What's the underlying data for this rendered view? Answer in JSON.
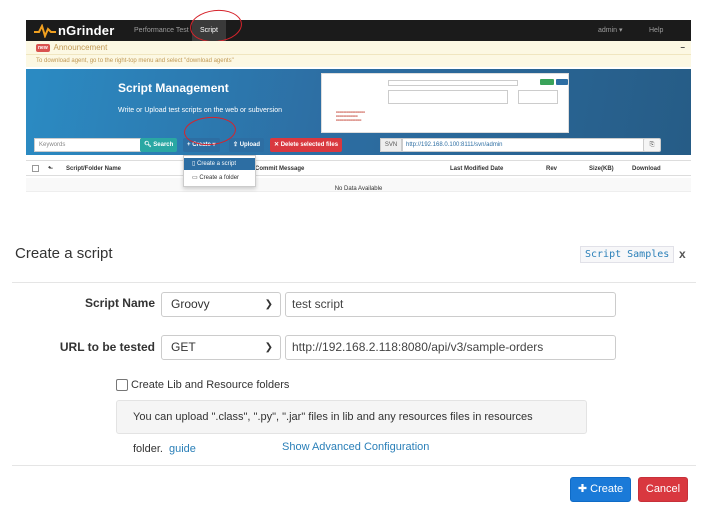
{
  "app": {
    "name": "nGrinder"
  },
  "nav": {
    "performance_test": "Performance Test",
    "script": "Script",
    "admin": "admin",
    "help": "Help"
  },
  "announcement": {
    "badge": "new",
    "title": "Announcement",
    "collapse": "–",
    "message": "To download agent, go to the right-top menu and select \"download agents\""
  },
  "banner": {
    "title": "Script Management",
    "subtitle": "Write or Upload test scripts on the web or subversion"
  },
  "toolbar": {
    "keywords_placeholder": "Keywords",
    "search": "Search",
    "create": "Create",
    "upload": "Upload",
    "delete_selected": "Delete selected files",
    "svn_label": "SVN",
    "svn_url": "http://192.168.0.100:8111/svn/admin"
  },
  "create_menu": {
    "items": [
      "Create a script",
      "Create a folder"
    ]
  },
  "table": {
    "headers": [
      "Script/Folder Name",
      "Commit Message",
      "Last Modified Date",
      "Rev",
      "Size(KB)",
      "Download"
    ],
    "empty": "No Data Available"
  },
  "modal": {
    "title": "Create a script",
    "samples": "Script Samples",
    "close": "x",
    "script_name_label": "Script Name",
    "script_type": "Groovy",
    "script_name_value": "test script",
    "url_label": "URL to be tested",
    "http_method": "GET",
    "url_value": "http://192.168.2.118:8080/api/v3/sample-orders",
    "lib_checkbox": "Create Lib and Resource folders",
    "info_text": "You can upload \".class\", \".py\", \".jar\" files in lib and any resources files in resources folder.",
    "guide": "guide",
    "advanced": "Show Advanced Configuration",
    "create_button": "Create",
    "cancel_button": "Cancel"
  },
  "colors": {
    "navbar": "#1b1b1b",
    "banner": "#2d6ea3",
    "primary": "#1a7ad8",
    "danger": "#d9383f",
    "success": "#3aa35a",
    "annotation": "#d6232b"
  }
}
